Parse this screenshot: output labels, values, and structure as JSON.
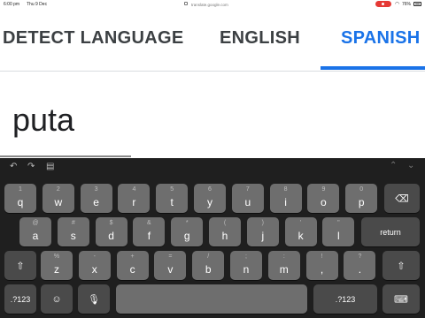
{
  "status_bar": {
    "time": "6:00 pm",
    "date": "Thu 9 Dec",
    "url": "translate.google.com",
    "battery": "76%"
  },
  "tabs": [
    {
      "label": "DETECT LANGUAGE"
    },
    {
      "label": "ENGLISH"
    },
    {
      "label": "SPANISH",
      "active": true
    }
  ],
  "source": {
    "text": "puta"
  },
  "keyboard": {
    "row1": [
      {
        "main": "q",
        "alt": "1"
      },
      {
        "main": "w",
        "alt": "2"
      },
      {
        "main": "e",
        "alt": "3"
      },
      {
        "main": "r",
        "alt": "4"
      },
      {
        "main": "t",
        "alt": "5"
      },
      {
        "main": "y",
        "alt": "6"
      },
      {
        "main": "u",
        "alt": "7"
      },
      {
        "main": "i",
        "alt": "8"
      },
      {
        "main": "o",
        "alt": "9"
      },
      {
        "main": "p",
        "alt": "0"
      }
    ],
    "row2": [
      {
        "main": "a",
        "alt": "@"
      },
      {
        "main": "s",
        "alt": "#"
      },
      {
        "main": "d",
        "alt": "$"
      },
      {
        "main": "f",
        "alt": "&"
      },
      {
        "main": "g",
        "alt": "*"
      },
      {
        "main": "h",
        "alt": "("
      },
      {
        "main": "j",
        "alt": ")"
      },
      {
        "main": "k",
        "alt": "'"
      },
      {
        "main": "l",
        "alt": "\""
      }
    ],
    "row3": [
      {
        "main": "z",
        "alt": "%"
      },
      {
        "main": "x",
        "alt": "-"
      },
      {
        "main": "c",
        "alt": "+"
      },
      {
        "main": "v",
        "alt": "="
      },
      {
        "main": "b",
        "alt": "/"
      },
      {
        "main": "n",
        "alt": ";"
      },
      {
        "main": "m",
        "alt": ":"
      },
      {
        "main": ",",
        "alt": "!"
      },
      {
        "main": ".",
        "alt": "?"
      }
    ],
    "return_label": "return",
    "numbers_label_left": ".?123",
    "numbers_label_right": ".?123",
    "icons": {
      "undo": "undo-icon",
      "redo": "redo-icon",
      "paste": "paste-icon",
      "delete": "backspace-icon",
      "shift": "shift-icon",
      "emoji": "emoji-icon",
      "mic": "microphone-icon",
      "hide": "keyboard-dismiss-icon",
      "up": "chevron-up-icon",
      "down": "chevron-down-icon"
    }
  }
}
